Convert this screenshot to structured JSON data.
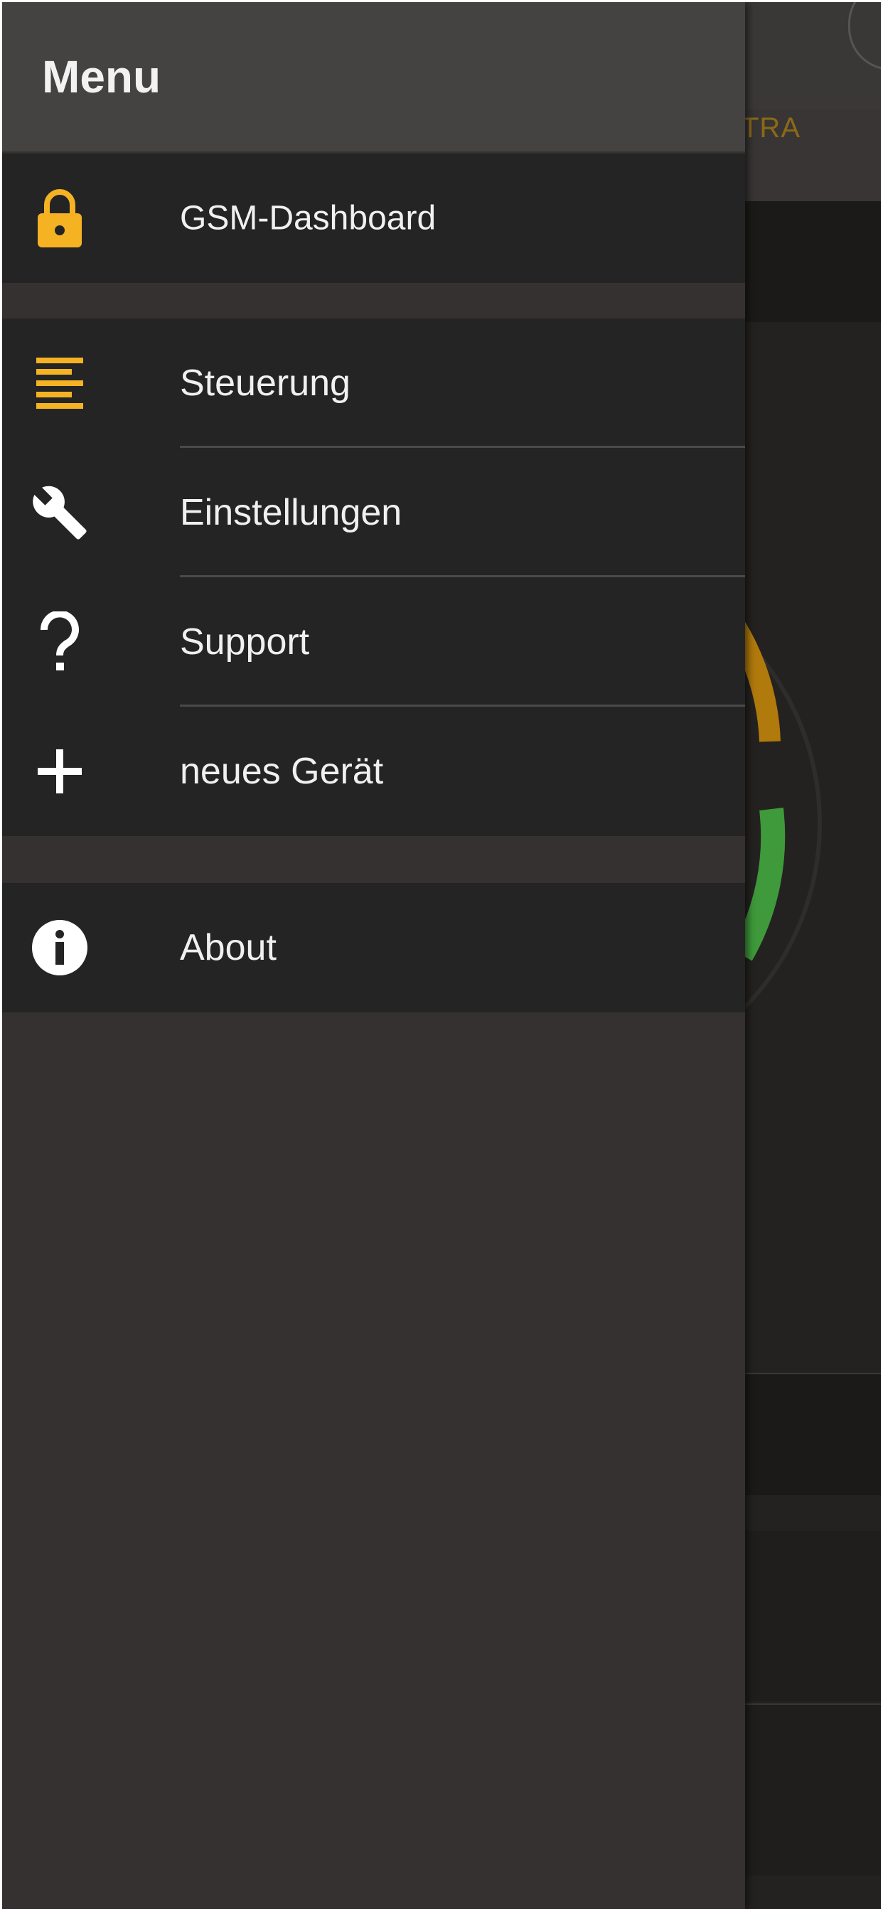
{
  "menu": {
    "title": "Menu"
  },
  "background": {
    "tab_label_partial": "TRA"
  },
  "groups": [
    {
      "items": [
        {
          "label": "GSM-Dashboard",
          "icon": "lock-icon",
          "icon_color": "#F5B323"
        }
      ]
    },
    {
      "items": [
        {
          "label": "Steuerung",
          "icon": "list-lines-icon",
          "icon_color": "#F5B323"
        },
        {
          "label": "Einstellungen",
          "icon": "wrench-icon",
          "icon_color": "#FFFFFF"
        },
        {
          "label": "Support",
          "icon": "question-mark-icon",
          "icon_color": "#FFFFFF"
        },
        {
          "label": "neues Gerät",
          "icon": "plus-icon",
          "icon_color": "#FFFFFF"
        }
      ]
    },
    {
      "items": [
        {
          "label": "About",
          "icon": "info-icon",
          "icon_color": "#FFFFFF"
        }
      ]
    }
  ],
  "colors": {
    "accent": "#F5B323",
    "drawer_bg": "#353130",
    "item_bg": "#242424",
    "header_bg": "#444342",
    "gauge_orange": "#B07A0C",
    "gauge_green": "#3E9A3A"
  }
}
